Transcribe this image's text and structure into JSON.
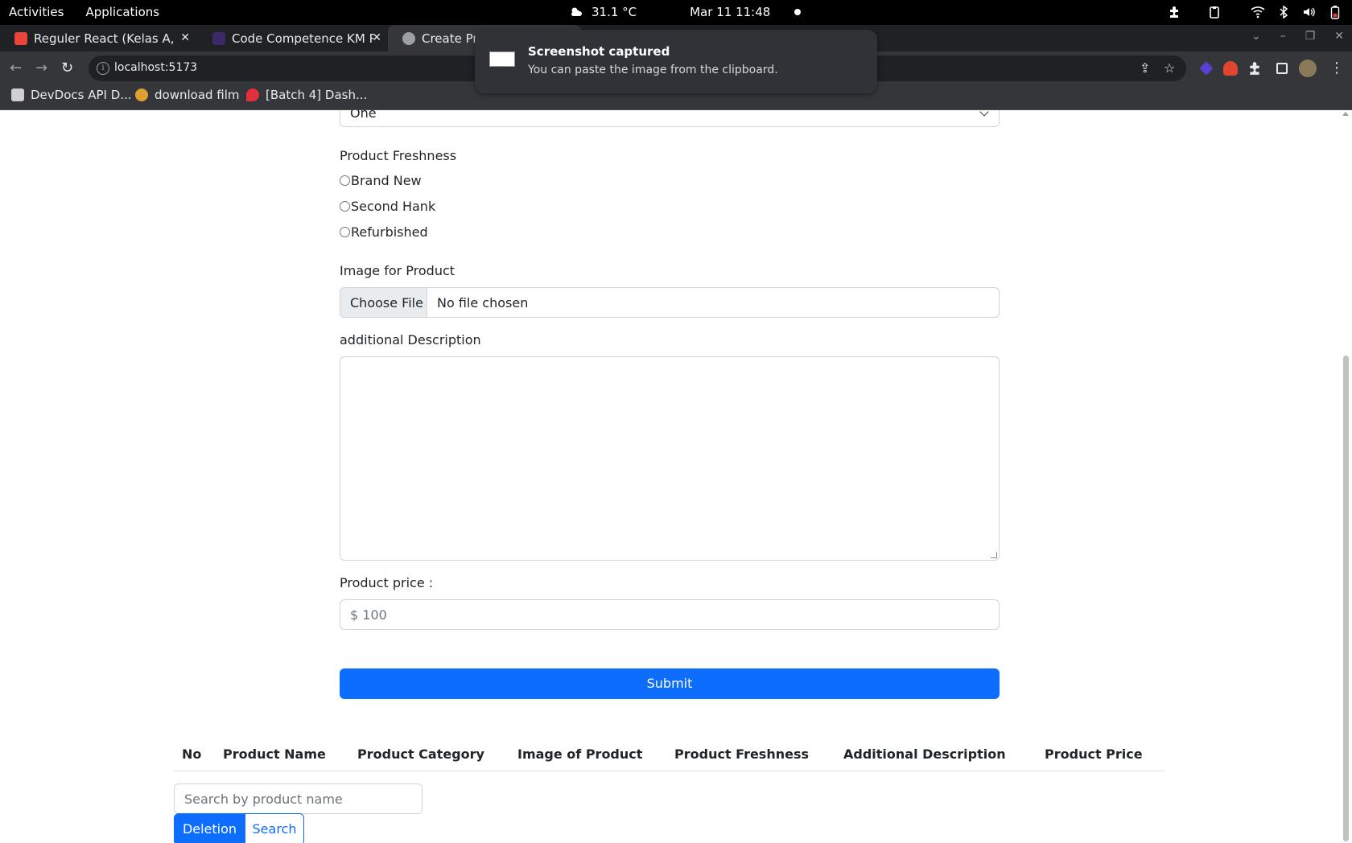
{
  "system_bar": {
    "activities": "Activities",
    "applications": "Applications",
    "weather": "31.1 °C",
    "clock": "Mar 11  11:48"
  },
  "tabs": [
    {
      "title": "Reguler React (Kelas A, B, C",
      "favicon_color": "#e8453c"
    },
    {
      "title": "Code Competence KM React",
      "favicon_color": "#3b2a66"
    },
    {
      "title": "Create Product",
      "favicon_color": "#9aa0a6"
    }
  ],
  "address_bar": {
    "url": "localhost:5173"
  },
  "bookmarks": [
    {
      "label": "DevDocs API D...",
      "icon_color": "#d0d0d0"
    },
    {
      "label": "download film",
      "icon_color": "#e0a030"
    },
    {
      "label": "[Batch 4] Dash...",
      "icon_color": "#e03040"
    }
  ],
  "notification": {
    "title": "Screenshot captured",
    "body": "You can paste the image from the clipboard."
  },
  "form": {
    "category_select_value": "One",
    "freshness_label": "Product Freshness",
    "freshness_options": [
      "Brand New",
      "Second Hank",
      "Refurbished"
    ],
    "image_label": "Image for Product",
    "file_button": "Choose File",
    "file_status": "No file chosen",
    "description_label": "additional Description",
    "description_value": "",
    "price_label": "Product price :",
    "price_placeholder": "$ 100",
    "submit_label": "Submit"
  },
  "table": {
    "headers": [
      "No",
      "Product Name",
      "Product Category",
      "Image of Product",
      "Product Freshness",
      "Additional Description",
      "Product Price"
    ]
  },
  "search": {
    "placeholder": "Search by product name",
    "deletion_label": "Deletion",
    "search_label": "Search"
  },
  "colors": {
    "primary": "#0d6efd",
    "topbar": "#000000",
    "browser_chrome": "#35363a"
  }
}
